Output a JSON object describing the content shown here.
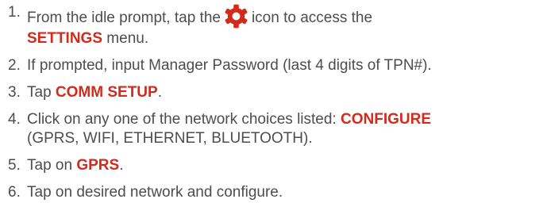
{
  "colors": {
    "text": "#4d4d4d",
    "accent": "#d42a1c"
  },
  "icons": {
    "settings": "gear-icon"
  },
  "steps": [
    {
      "num": "1.",
      "a": "From the idle prompt, tap the",
      "b": "icon to access the",
      "c": "SETTINGS",
      "d": "menu."
    },
    {
      "num": "2.",
      "a": "If prompted, input Manager Password (last 4 digits of TPN#)."
    },
    {
      "num": "3.",
      "a": "Tap",
      "b": "COMM SETUP",
      "c": "."
    },
    {
      "num": "4.",
      "a": "Click on any one of the network choices listed:",
      "b": "CONFIGURE",
      "c": "(GPRS, WIFI, ETHERNET, BLUETOOTH)."
    },
    {
      "num": "5.",
      "a": "Tap on",
      "b": "GPRS",
      "c": "."
    },
    {
      "num": "6.",
      "a": "Tap on desired network and configure."
    }
  ]
}
